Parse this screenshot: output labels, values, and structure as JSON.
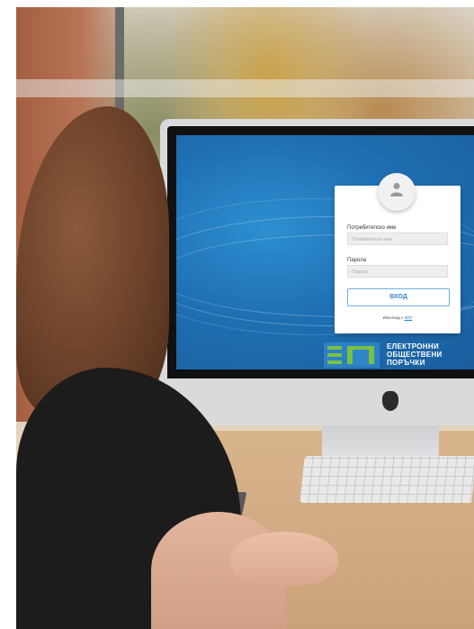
{
  "login": {
    "username_label": "Потребителско име",
    "username_placeholder": "Потребителско име",
    "password_label": "Парола",
    "password_placeholder": "Парола",
    "submit_label": "ВХОД",
    "eid_text": "Или вход с",
    "eid_link": "КЕП"
  },
  "brand": {
    "line1": "ЕЛЕКТРОННИ",
    "line2": "ОБЩЕСТВЕНИ",
    "line3": "ПОРЪЧКИ"
  },
  "colors": {
    "screen_blue": "#1f6fb3",
    "brand_green": "#7ac043",
    "brand_blue": "#2e86c9"
  },
  "icons": {
    "avatar": "user-icon",
    "computer_logo": "apple-logo-icon"
  }
}
